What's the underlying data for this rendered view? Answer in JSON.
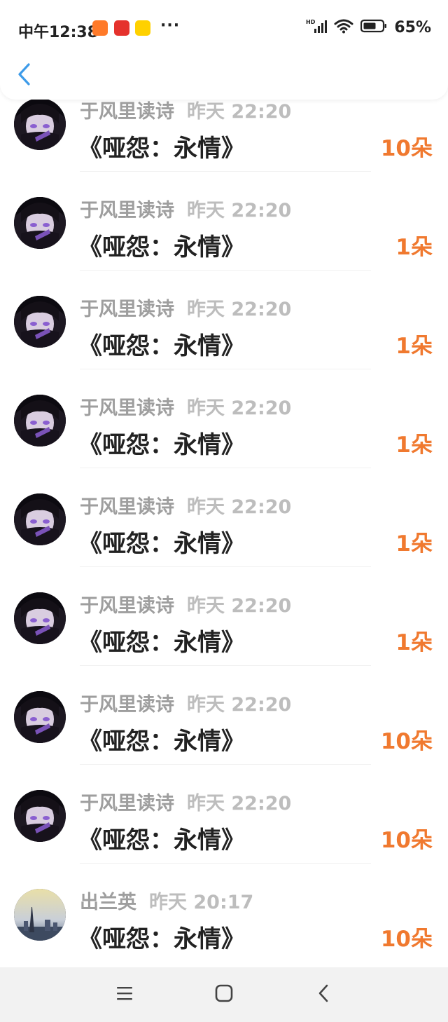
{
  "status_bar": {
    "time": "中午12:38",
    "more": "···",
    "battery": "65%",
    "apps": [
      "taobao-icon",
      "kanshan-icon",
      "meituan-icon"
    ]
  },
  "nav": {
    "back_icon": "chevron-left-icon",
    "accent_color": "#3d9be9"
  },
  "colors": {
    "gift": "#f0792f",
    "name": "#9e9e9e",
    "time": "#bdbdbd",
    "title": "#222222"
  },
  "records": [
    {
      "name": "于风里读诗",
      "time": "昨天 22:20",
      "title": "《哑怨：永情》",
      "gift": "10朵"
    },
    {
      "name": "于风里读诗",
      "time": "昨天 22:20",
      "title": "《哑怨：永情》",
      "gift": "1朵"
    },
    {
      "name": "于风里读诗",
      "time": "昨天 22:20",
      "title": "《哑怨：永情》",
      "gift": "1朵"
    },
    {
      "name": "于风里读诗",
      "time": "昨天 22:20",
      "title": "《哑怨：永情》",
      "gift": "1朵"
    },
    {
      "name": "于风里读诗",
      "time": "昨天 22:20",
      "title": "《哑怨：永情》",
      "gift": "1朵"
    },
    {
      "name": "于风里读诗",
      "time": "昨天 22:20",
      "title": "《哑怨：永情》",
      "gift": "1朵"
    },
    {
      "name": "于风里读诗",
      "time": "昨天 22:20",
      "title": "《哑怨：永情》",
      "gift": "10朵"
    },
    {
      "name": "于风里读诗",
      "time": "昨天 22:20",
      "title": "《哑怨：永情》",
      "gift": "10朵"
    },
    {
      "name": "出兰英",
      "time": "昨天 20:17",
      "title": "《哑怨：永情》",
      "gift": "10朵"
    }
  ]
}
